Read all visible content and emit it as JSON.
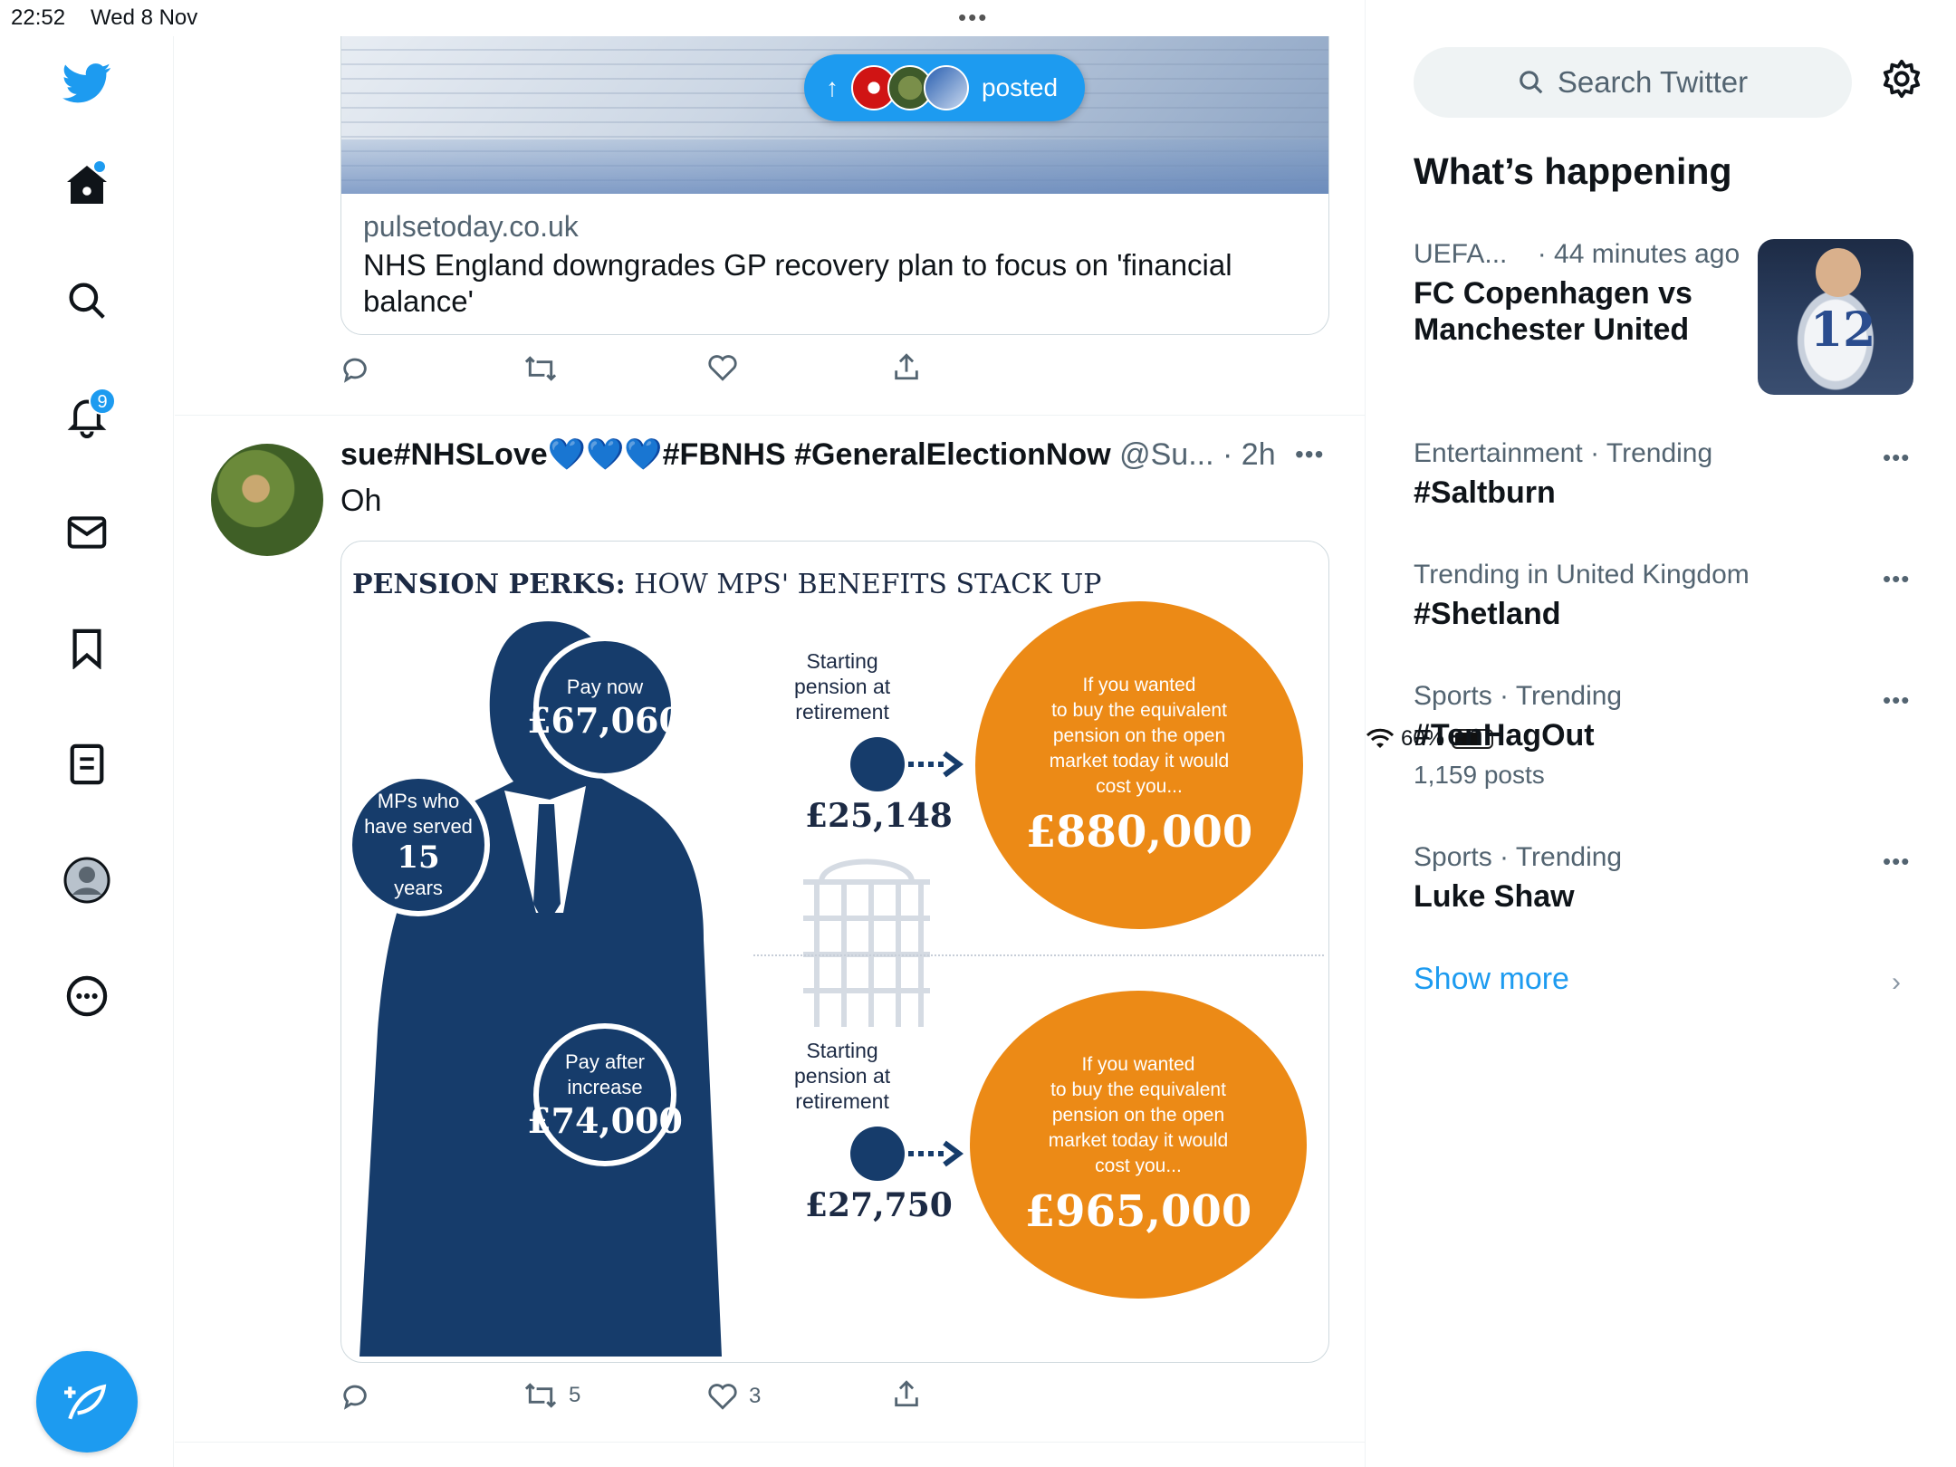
{
  "status_bar": {
    "time": "22:52",
    "date": "Wed 8 Nov",
    "battery": "60%"
  },
  "nav": {
    "notifications_count": "9"
  },
  "top_card": {
    "domain": "pulsetoday.co.uk",
    "headline": "NHS England downgrades GP recovery plan to focus on 'financial balance'"
  },
  "posted_pill": {
    "label": "posted"
  },
  "tweet": {
    "name": "sue#NHSLove💙💙💙#FBNHS #GeneralElectionNow",
    "handle": "@Su...",
    "time": "· 2h",
    "text": "Oh",
    "retweets": "5",
    "likes": "3"
  },
  "infographic": {
    "title_bold": "PENSION PERKS:",
    "title_rest": " HOW MPS' BENEFITS STACK UP",
    "served": {
      "line1": "MPs who",
      "line2": "have served",
      "years": "15",
      "line3": "years"
    },
    "pay_now": {
      "label": "Pay now",
      "value": "£67,060"
    },
    "pay_after": {
      "label1": "Pay after",
      "label2": "increase",
      "value": "£74,000"
    },
    "starting_label": [
      "Starting",
      "pension at",
      "retirement"
    ],
    "start_now": "£25,148",
    "start_after": "£27,750",
    "cost_text": [
      "If you wanted",
      "to buy the equivalent",
      "pension on the open",
      "market today it would",
      "cost you..."
    ],
    "cost_now": "£880,000",
    "cost_after": "£965,000"
  },
  "sidebar": {
    "search_placeholder": "Search Twitter",
    "heading": "What’s happening",
    "trends": [
      {
        "context": "UEFA...",
        "time": "· 44 minutes ago",
        "title": "FC Copenhagen vs Manchester United",
        "count": ""
      },
      {
        "context": "Entertainment · Trending",
        "title": "#Saltburn",
        "count": ""
      },
      {
        "context": "Trending in United Kingdom",
        "title": "#Shetland",
        "count": ""
      },
      {
        "context": "Sports · Trending",
        "title": "#TenHagOut",
        "count": "1,159 posts"
      },
      {
        "context": "Sports · Trending",
        "title": "Luke Shaw",
        "count": ""
      }
    ],
    "show_more": "Show more"
  },
  "colors": {
    "accent": "#1d9bf0",
    "navy": "#163c6b",
    "orange": "#ec8a16"
  }
}
